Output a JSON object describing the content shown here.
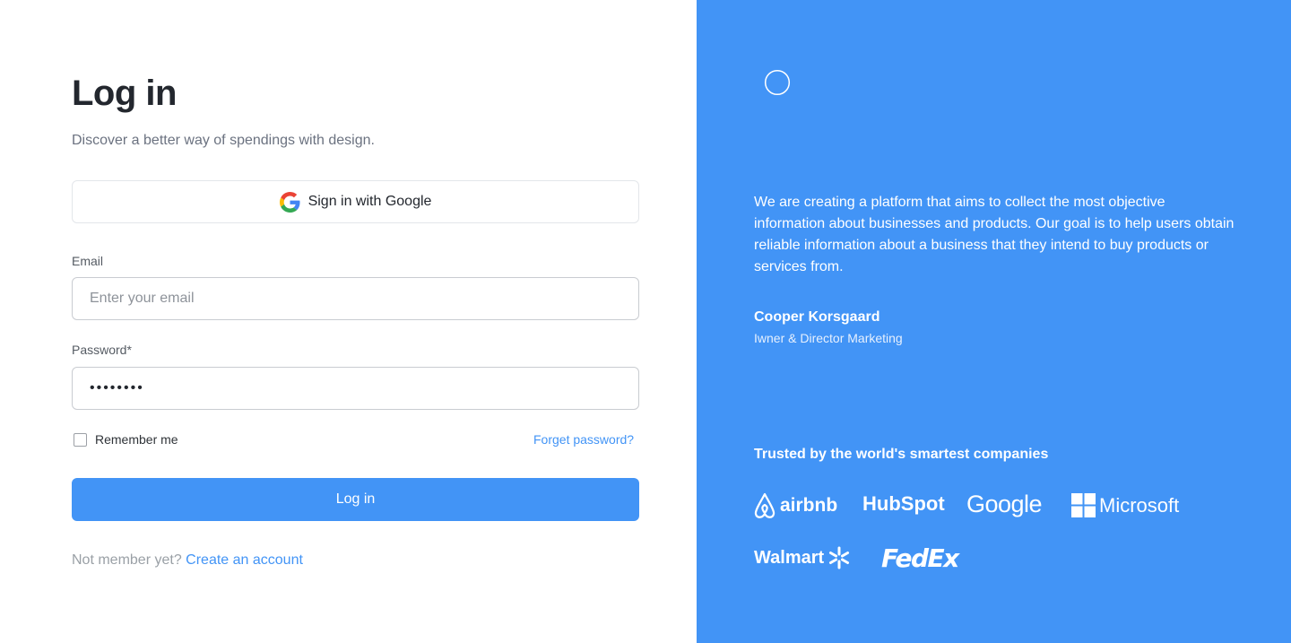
{
  "login": {
    "title": "Log in",
    "subtitle": "Discover a better way of spendings with design.",
    "google_button": "Sign in with Google",
    "email_label": "Email",
    "email_placeholder": "Enter your email",
    "password_label": "Password*",
    "password_value": "••••••••",
    "remember_label": "Remember me",
    "forgot_link": "Forget password?",
    "submit_label": "Log in",
    "signup_prompt": "Not member yet?",
    "signup_link": "Create an account"
  },
  "panel": {
    "quote": "We are creating a platform that aims to collect the most objective information about businesses and products. Our goal is to help users obtain reliable information about a business that they intend to buy products or services from.",
    "author_name": "Cooper Korsgaard",
    "author_role": "Iwner & Director Marketing",
    "trusted_heading": "Trusted by the world's smartest companies",
    "companies": [
      "airbnb",
      "HubSpot",
      "Google",
      "Microsoft",
      "Walmart",
      "FedEx"
    ]
  },
  "colors": {
    "accent": "#4294f6",
    "panel_bg": "#4294f6",
    "text_dark": "#23272e",
    "text_muted": "#6b7280"
  }
}
